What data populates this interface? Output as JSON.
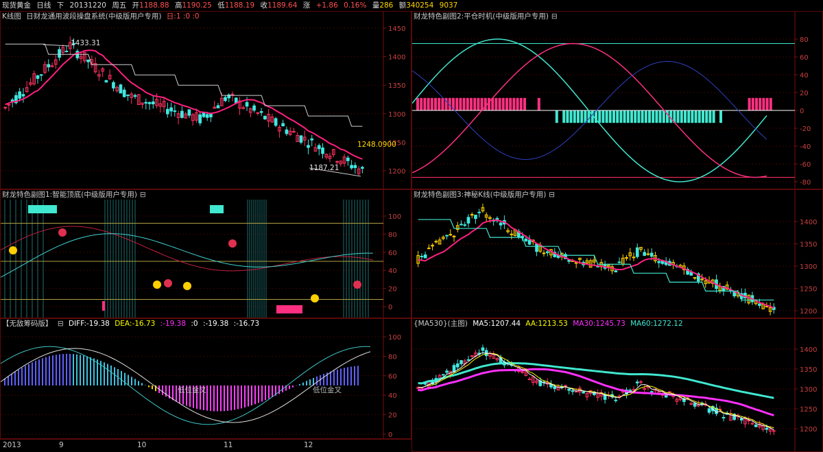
{
  "topbar": {
    "symbol": "现货黄金",
    "period": "日线",
    "arrow": "下",
    "date": "20131220",
    "weekday": "周五",
    "open_label": "开",
    "open": "1188.88",
    "high_label": "高",
    "high": "1190.25",
    "low_label": "低",
    "low": "1188.19",
    "close_label": "收",
    "close": "1189.64",
    "chg_label": "涨",
    "chg": "+1.86",
    "chg_pct": "0.16%",
    "vol_label": "量",
    "vol": "286",
    "amt_label": "额",
    "amt": "340254",
    "extra": "9037"
  },
  "panels": {
    "kline": {
      "title": "K线图",
      "indicator": "日财龙通用波段操盘系统(中级版用户专用)",
      "params": "日:1 :0 :0",
      "high_mark": "1433.31",
      "low_mark": "1187.21",
      "price_mark": "1248.0900",
      "yticks": [
        "1450",
        "1400",
        "1350",
        "1300",
        "1250",
        "1200"
      ]
    },
    "sub1": {
      "title": "财龙特色副图1:智能顶底(中级版用户专用)",
      "yticks": [
        "100",
        "80",
        "60",
        "40",
        "20",
        "0"
      ]
    },
    "sub2": {
      "title": "财龙特色副图2:平仓时机(中级版用户专用)",
      "yticks": [
        "80",
        "60",
        "40",
        "20",
        "0",
        "-20",
        "-40",
        "-60",
        "-80"
      ]
    },
    "sub3": {
      "title": "财龙特色副图3:神秘K线(中级版用户专用)",
      "yticks": [
        "1400",
        "1350",
        "1300",
        "1250",
        "1200"
      ]
    },
    "macd": {
      "title": "【无敌筹码版】",
      "diff_label": "DIFF:-19.38",
      "dea_label": "DEA:-16.73",
      "v3": ":-19.38",
      "v4": ":0",
      "v5": ":-19.38",
      "v6": ":-16.73",
      "annot1": "低位金叉",
      "annot2": "低位金叉",
      "yticks": [
        "100",
        "80",
        "60",
        "40",
        "20",
        "0"
      ]
    },
    "ma": {
      "title": "{MA530}(主图)",
      "ma5": "MA5:1207.44",
      "aa": "AA:1213.53",
      "ma30": "MA30:1245.73",
      "ma60": "MA60:1272.12",
      "yticks": [
        "1400",
        "1350",
        "1300",
        "1250",
        "1200"
      ]
    }
  },
  "xaxis": [
    "2013",
    "9",
    "10",
    "11",
    "12"
  ],
  "colors": {
    "up": "#ff3060",
    "down": "#40e8e0",
    "border": "#5a0a0a",
    "axis_text": "#c84040",
    "ma5": "#ffffff",
    "aa": "#ffff00",
    "ma30": "#ff30ff",
    "ma60": "#40e8d0"
  }
}
